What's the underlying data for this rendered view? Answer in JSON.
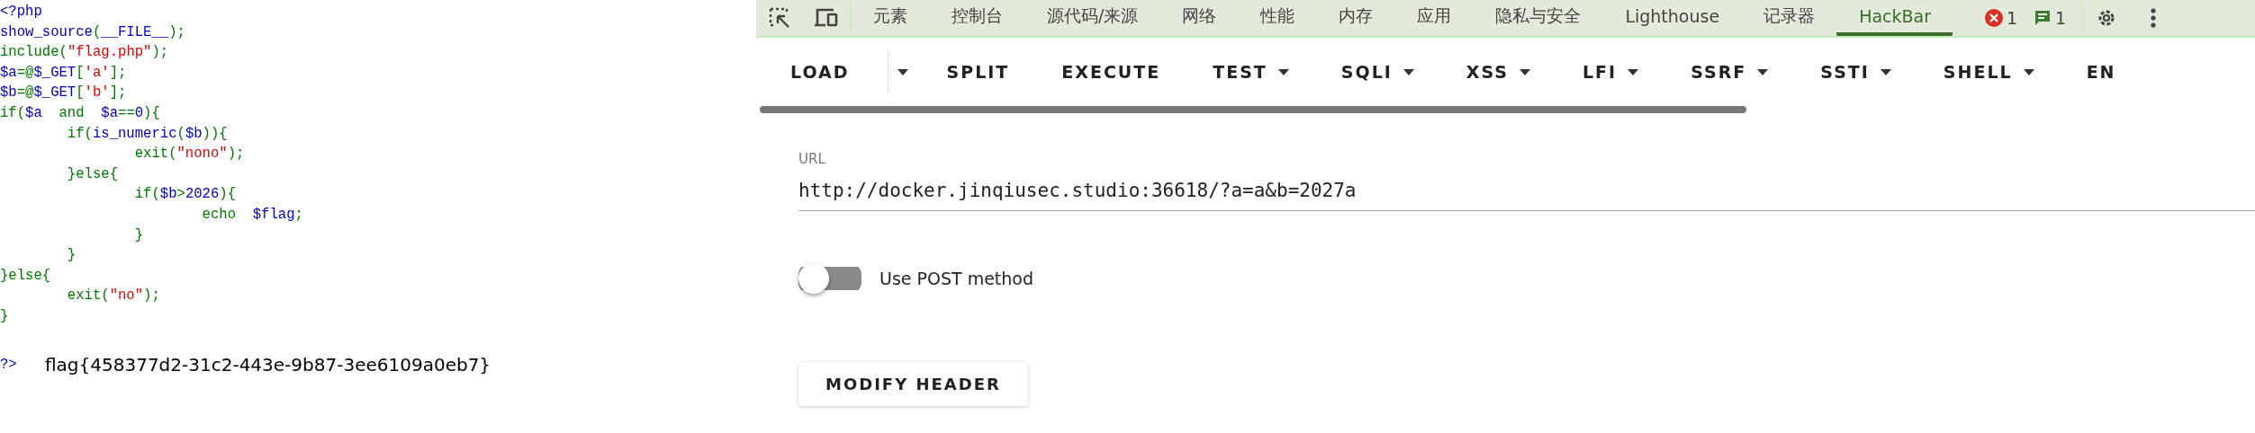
{
  "source_code": {
    "lines": [
      [
        {
          "text": "<?php",
          "kind": "var"
        }
      ],
      [
        {
          "text": "show_source",
          "kind": "var"
        },
        {
          "text": "(",
          "kind": "keyword"
        },
        {
          "text": "__FILE__",
          "kind": "var"
        },
        {
          "text": ");",
          "kind": "keyword"
        }
      ],
      [
        {
          "text": "include(",
          "kind": "keyword"
        },
        {
          "text": "\"flag.php\"",
          "kind": "string"
        },
        {
          "text": ");",
          "kind": "keyword"
        }
      ],
      [
        {
          "text": "$a",
          "kind": "var"
        },
        {
          "text": "=@",
          "kind": "keyword"
        },
        {
          "text": "$_GET",
          "kind": "var"
        },
        {
          "text": "[",
          "kind": "keyword"
        },
        {
          "text": "'a'",
          "kind": "string"
        },
        {
          "text": "];",
          "kind": "keyword"
        }
      ],
      [
        {
          "text": "$b",
          "kind": "var"
        },
        {
          "text": "=@",
          "kind": "keyword"
        },
        {
          "text": "$_GET",
          "kind": "var"
        },
        {
          "text": "[",
          "kind": "keyword"
        },
        {
          "text": "'b'",
          "kind": "string"
        },
        {
          "text": "];",
          "kind": "keyword"
        }
      ],
      [
        {
          "text": "if(",
          "kind": "keyword"
        },
        {
          "text": "$a",
          "kind": "var"
        },
        {
          "text": "  and  ",
          "kind": "keyword"
        },
        {
          "text": "$a",
          "kind": "var"
        },
        {
          "text": "==",
          "kind": "keyword"
        },
        {
          "text": "0",
          "kind": "var"
        },
        {
          "text": "){",
          "kind": "keyword"
        }
      ],
      [
        {
          "text": "        if(",
          "kind": "keyword"
        },
        {
          "text": "is_numeric",
          "kind": "var"
        },
        {
          "text": "(",
          "kind": "keyword"
        },
        {
          "text": "$b",
          "kind": "var"
        },
        {
          "text": ")){",
          "kind": "keyword"
        }
      ],
      [
        {
          "text": "                exit(",
          "kind": "keyword"
        },
        {
          "text": "\"nono\"",
          "kind": "string"
        },
        {
          "text": ");",
          "kind": "keyword"
        }
      ],
      [
        {
          "text": "        }else{",
          "kind": "keyword"
        }
      ],
      [
        {
          "text": "                if(",
          "kind": "keyword"
        },
        {
          "text": "$b",
          "kind": "var"
        },
        {
          "text": ">",
          "kind": "keyword"
        },
        {
          "text": "2026",
          "kind": "var"
        },
        {
          "text": "){",
          "kind": "keyword"
        }
      ],
      [
        {
          "text": "                        echo  ",
          "kind": "keyword"
        },
        {
          "text": "$flag",
          "kind": "var"
        },
        {
          "text": ";",
          "kind": "keyword"
        }
      ],
      [
        {
          "text": "                }",
          "kind": "keyword"
        }
      ],
      [
        {
          "text": "        }",
          "kind": "keyword"
        }
      ],
      [
        {
          "text": "}else{",
          "kind": "keyword"
        }
      ],
      [
        {
          "text": "        exit(",
          "kind": "keyword"
        },
        {
          "text": "\"no\"",
          "kind": "string"
        },
        {
          "text": ");",
          "kind": "keyword"
        }
      ],
      [
        {
          "text": "}",
          "kind": "keyword"
        }
      ]
    ],
    "closing_tag": "?>",
    "output": "flag{458377d2-31c2-443e-9b87-3ee6109a0eb7}"
  },
  "devtools": {
    "tabs": [
      {
        "label": "元素",
        "selected": false
      },
      {
        "label": "控制台",
        "selected": false
      },
      {
        "label": "源代码/来源",
        "selected": false
      },
      {
        "label": "网络",
        "selected": false
      },
      {
        "label": "性能",
        "selected": false
      },
      {
        "label": "内存",
        "selected": false
      },
      {
        "label": "应用",
        "selected": false
      },
      {
        "label": "隐私与安全",
        "selected": false
      },
      {
        "label": "Lighthouse",
        "selected": false
      },
      {
        "label": "记录器",
        "selected": false
      },
      {
        "label": "HackBar",
        "selected": true
      }
    ],
    "error_count": "1",
    "message_count": "1"
  },
  "hackbar": {
    "toolbar": [
      {
        "label": "LOAD",
        "kind": "split"
      },
      {
        "label": "SPLIT",
        "kind": "plain"
      },
      {
        "label": "EXECUTE",
        "kind": "plain"
      },
      {
        "label": "TEST",
        "kind": "menu"
      },
      {
        "label": "SQLI",
        "kind": "menu"
      },
      {
        "label": "XSS",
        "kind": "menu"
      },
      {
        "label": "LFI",
        "kind": "menu"
      },
      {
        "label": "SSRF",
        "kind": "menu"
      },
      {
        "label": "SSTI",
        "kind": "menu"
      },
      {
        "label": "SHELL",
        "kind": "menu"
      },
      {
        "label": "EN",
        "kind": "plain"
      }
    ],
    "url": {
      "label": "URL",
      "value": "http://docker.jinqiusec.studio:36618/?a=a&b=2027a"
    },
    "post_toggle": {
      "label": "Use POST method",
      "on": false
    },
    "buttons": [
      "MODIFY HEADER"
    ]
  }
}
